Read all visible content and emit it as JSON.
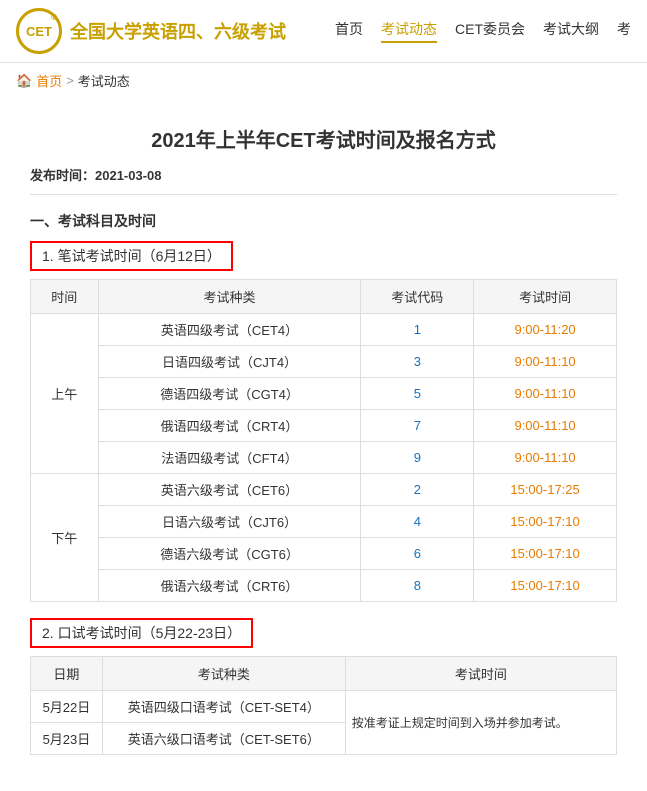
{
  "header": {
    "logo_text": "CET",
    "site_title": "全国大学英语四、六级考试",
    "nav": [
      {
        "label": "首页",
        "active": false
      },
      {
        "label": "考试动态",
        "active": true
      },
      {
        "label": "CET委员会",
        "active": false
      },
      {
        "label": "考试大纲",
        "active": false
      },
      {
        "label": "考",
        "active": false
      }
    ]
  },
  "breadcrumb": {
    "home": "首页",
    "separator": ">",
    "current": "考试动态"
  },
  "article": {
    "title": "2021年上半年CET考试时间及报名方式",
    "publish_label": "发布时间：",
    "publish_date": "2021-03-08",
    "section1_heading": "一、考试科目及时间",
    "written_exam_label": "1. 笔试考试时间（6月12日）",
    "oral_exam_label": "2. 口试考试时间（5月22-23日）"
  },
  "written_table": {
    "headers": [
      "时间",
      "考试种类",
      "考试代码",
      "考试时间"
    ],
    "rows": [
      {
        "period": "上午",
        "name": "英语四级考试（CET4）",
        "code": "1",
        "time": "9:00-11:20"
      },
      {
        "period": "",
        "name": "日语四级考试（CJT4）",
        "code": "3",
        "time": "9:00-11:10"
      },
      {
        "period": "",
        "name": "德语四级考试（CGT4）",
        "code": "5",
        "time": "9:00-11:10"
      },
      {
        "period": "",
        "name": "俄语四级考试（CRT4）",
        "code": "7",
        "time": "9:00-11:10"
      },
      {
        "period": "",
        "name": "法语四级考试（CFT4）",
        "code": "9",
        "time": "9:00-11:10"
      },
      {
        "period": "下午",
        "name": "英语六级考试（CET6）",
        "code": "2",
        "time": "15:00-17:25"
      },
      {
        "period": "",
        "name": "日语六级考试（CJT6）",
        "code": "4",
        "time": "15:00-17:10"
      },
      {
        "period": "",
        "name": "德语六级考试（CGT6）",
        "code": "6",
        "time": "15:00-17:10"
      },
      {
        "period": "",
        "name": "俄语六级考试（CRT6）",
        "code": "8",
        "time": "15:00-17:10"
      }
    ]
  },
  "oral_table": {
    "headers": [
      "日期",
      "考试种类",
      "考试时间"
    ],
    "rows": [
      {
        "date": "5月22日",
        "name": "英语四级口语考试（CET-SET4）",
        "time": "按准考证上规定时间到入场并参加考试。"
      },
      {
        "date": "5月23日",
        "name": "英语六级口语考试（CET-SET6）",
        "time": ""
      }
    ]
  },
  "colors": {
    "orange": "#e57c00",
    "blue": "#1a6fbf",
    "red_border": "#dd0000",
    "gold": "#c8a000"
  }
}
